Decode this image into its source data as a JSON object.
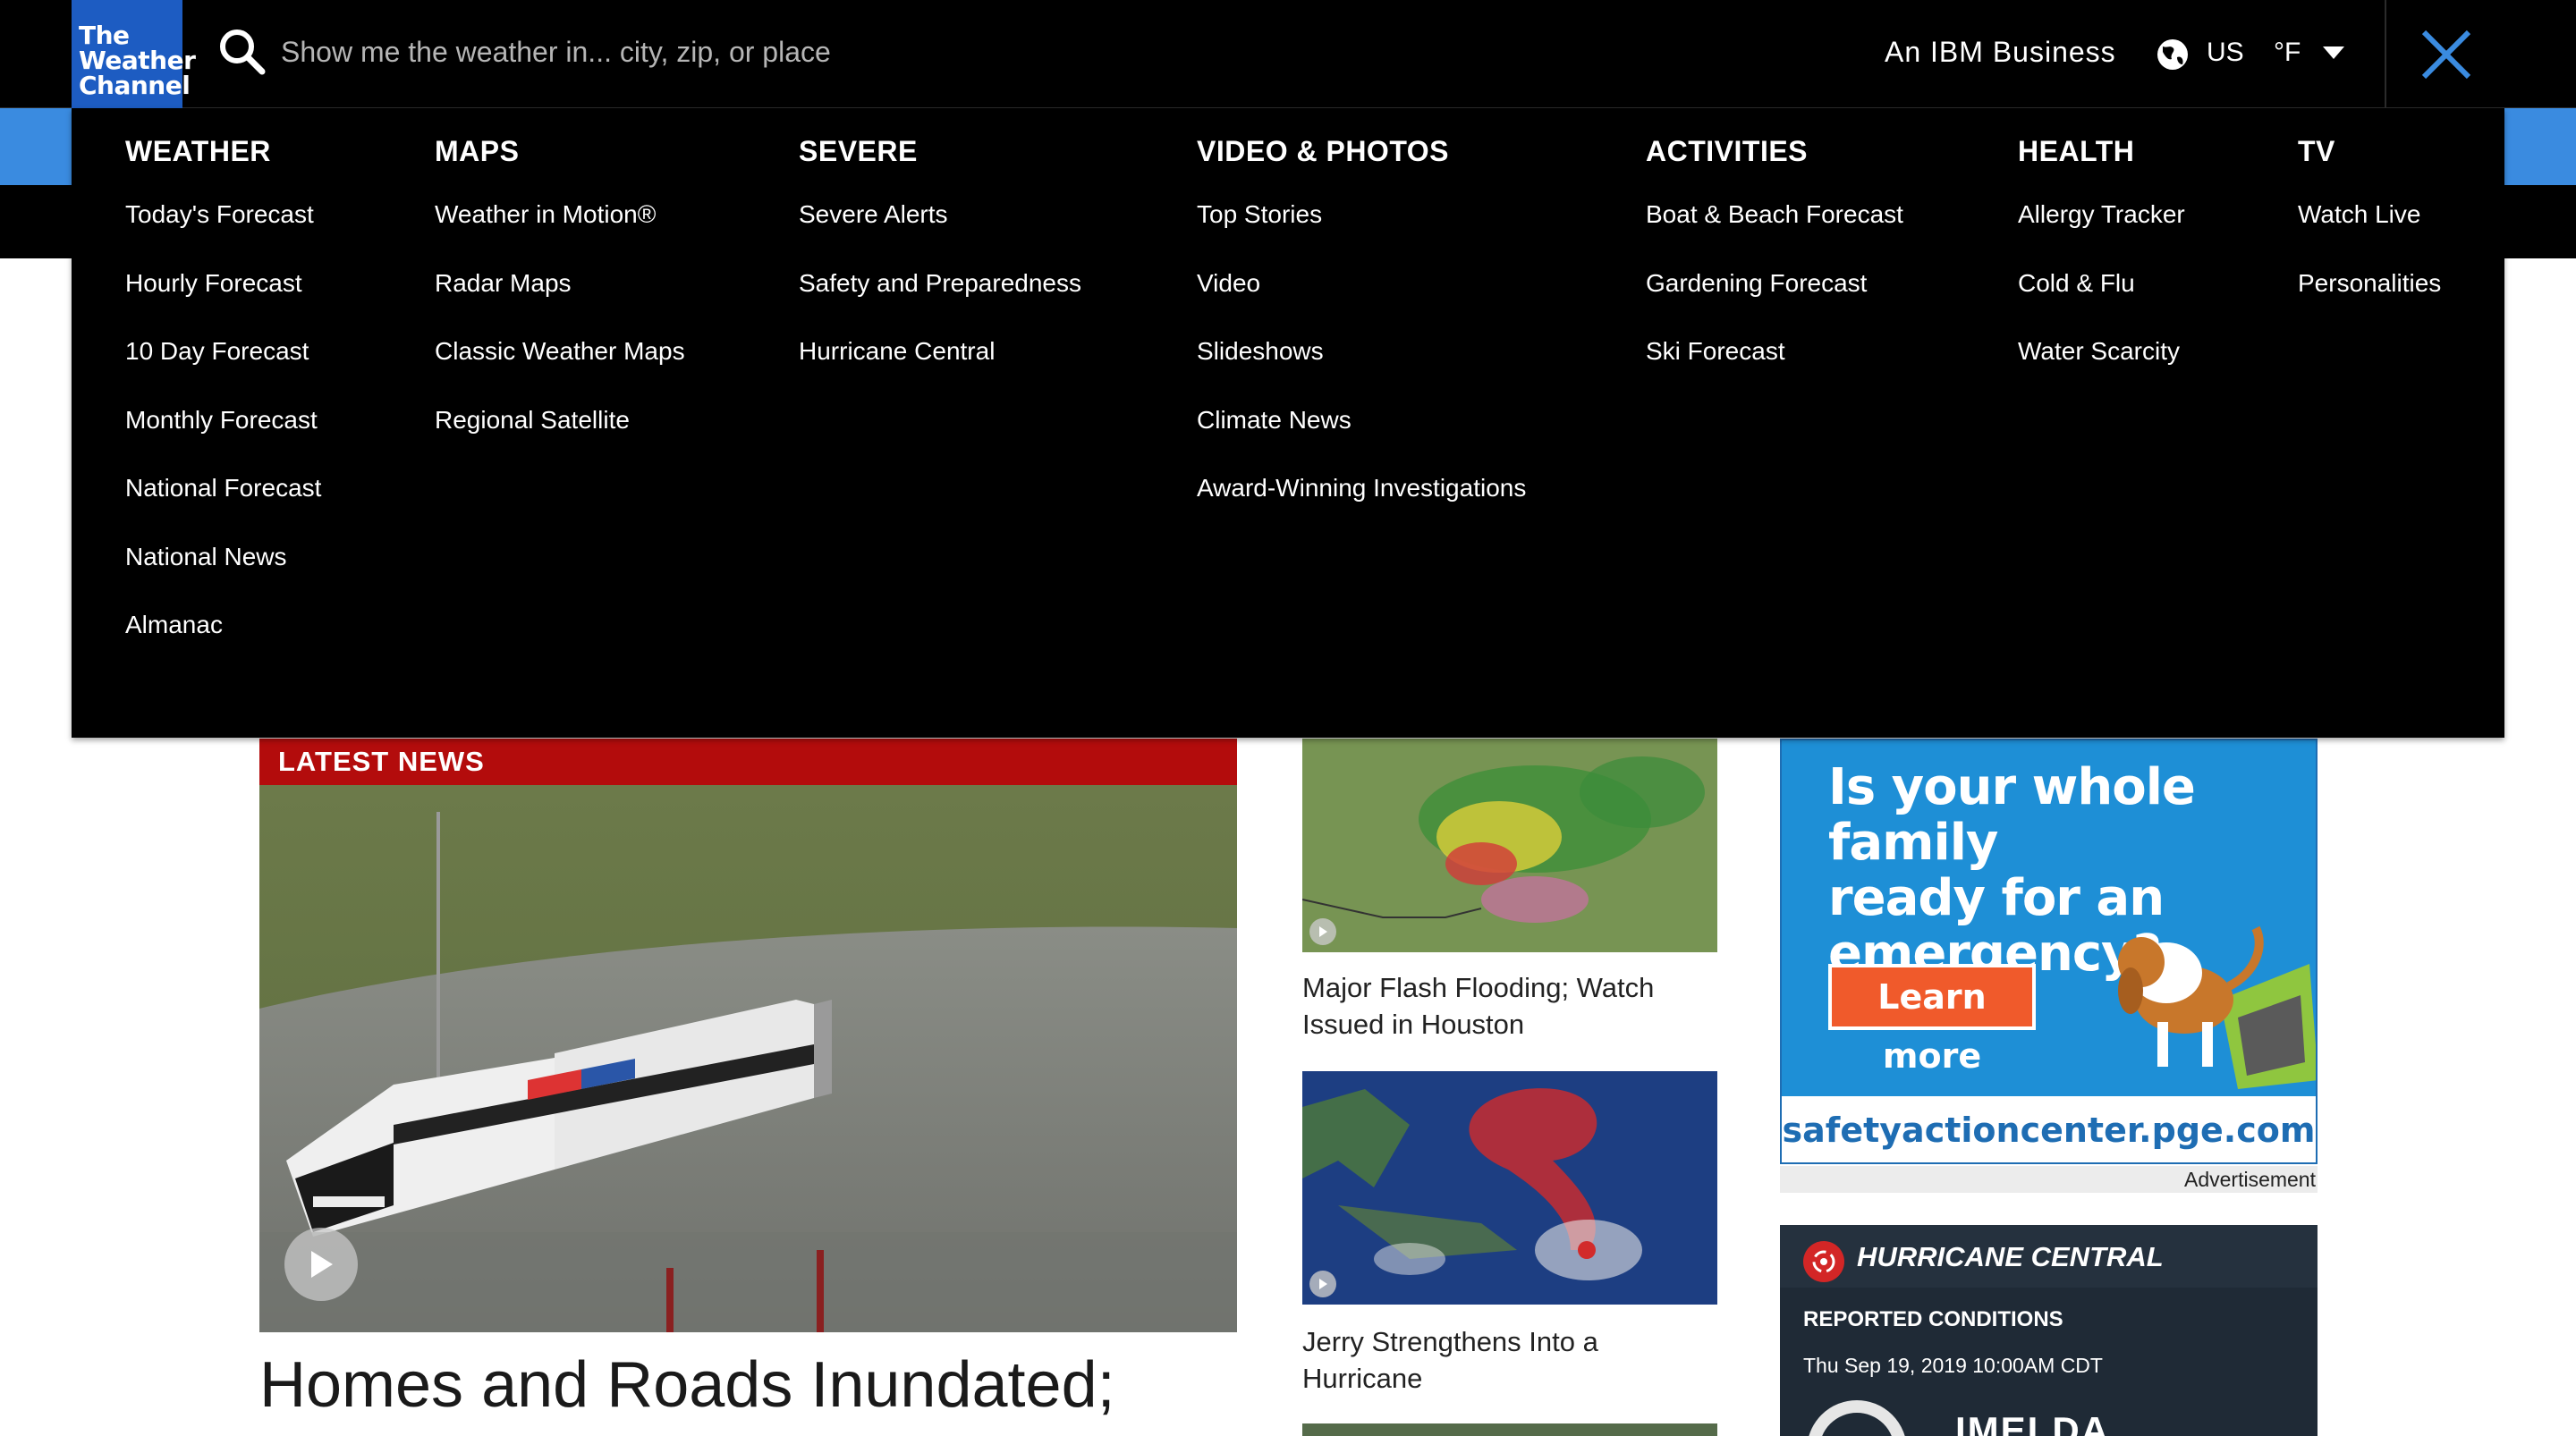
{
  "header": {
    "logo_lines": [
      "The",
      "Weather",
      "Channel"
    ],
    "search_placeholder": "Show me the weather in... city, zip, or place",
    "ibm": "An IBM Business",
    "country": "US",
    "unit": "°F"
  },
  "menu": [
    {
      "title": "WEATHER",
      "items": [
        "Today's Forecast",
        "Hourly Forecast",
        "10 Day Forecast",
        "Monthly Forecast",
        "National Forecast",
        "National News",
        "Almanac"
      ]
    },
    {
      "title": "MAPS",
      "items": [
        "Weather in Motion®",
        "Radar Maps",
        "Classic Weather Maps",
        "Regional Satellite"
      ]
    },
    {
      "title": "SEVERE",
      "items": [
        "Severe Alerts",
        "Safety and Preparedness",
        "Hurricane Central"
      ]
    },
    {
      "title": "VIDEO & PHOTOS",
      "items": [
        "Top Stories",
        "Video",
        "Slideshows",
        "Climate News",
        "Award-Winning Investigations"
      ]
    },
    {
      "title": "ACTIVITIES",
      "items": [
        "Boat & Beach Forecast",
        "Gardening Forecast",
        "Ski Forecast"
      ]
    },
    {
      "title": "HEALTH",
      "items": [
        "Allergy Tracker",
        "Cold & Flu",
        "Water Scarcity"
      ]
    },
    {
      "title": "TV",
      "items": [
        "Watch Live",
        "Personalities"
      ]
    }
  ],
  "latest_news": {
    "label": "LATEST NEWS",
    "headline": "Homes and Roads Inundated;"
  },
  "stories": [
    {
      "caption_lines": [
        "Major Flash Flooding; Watch",
        "Issued in Houston"
      ]
    },
    {
      "caption_lines": [
        "Jerry Strengthens Into a",
        "Hurricane"
      ]
    }
  ],
  "ad": {
    "headline_lines": [
      "Is your whole family",
      "ready for an",
      "emergency?"
    ],
    "button": "Learn more",
    "url": "safetyactioncenter.pge.com",
    "label": "Advertisement"
  },
  "hurricane_central": {
    "title": "HURRICANE CENTRAL",
    "reported": "REPORTED CONDITIONS",
    "date": "Thu Sep 19, 2019 10:00AM CDT",
    "storm_name": "IMELDA"
  },
  "colors": {
    "brand_blue": "#1d5cc2",
    "accent_blue": "#3a8be0",
    "news_red": "#b30c0c",
    "close_x": "#3a8be0"
  }
}
